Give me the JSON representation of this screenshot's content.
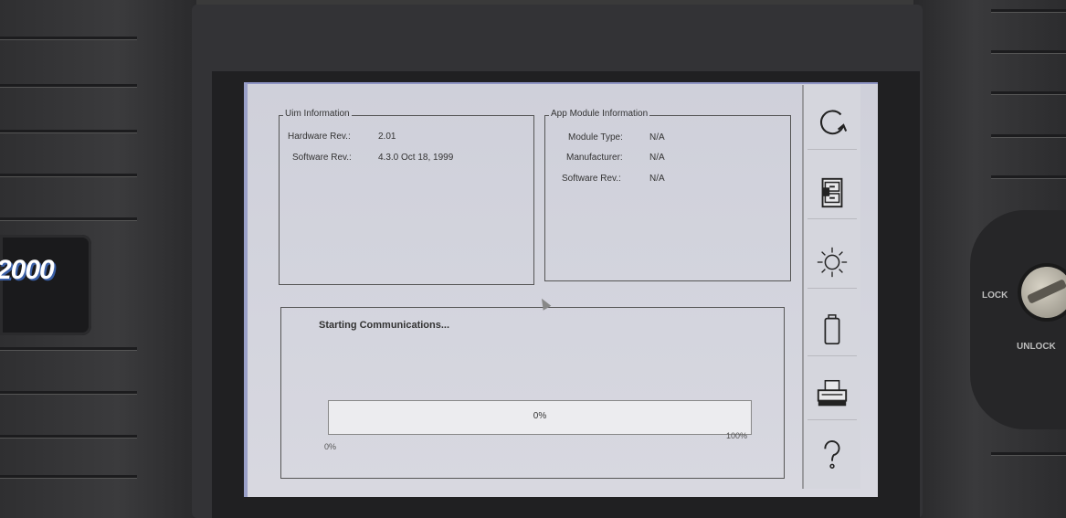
{
  "device": {
    "badge": "2000",
    "lock_label": "LOCK",
    "unlock_label": "UNLOCK"
  },
  "uim_info": {
    "title": "Uim Information",
    "rows": [
      {
        "label": "Hardware Rev.:",
        "value": "2.01"
      },
      {
        "label": "Software Rev.:",
        "value": "4.3.0 Oct 18, 1999"
      }
    ]
  },
  "app_module_info": {
    "title": "App Module Information",
    "rows": [
      {
        "label": "Module Type:",
        "value": "N/A"
      },
      {
        "label": "Manufacturer:",
        "value": "N/A"
      },
      {
        "label": "Software Rev.:",
        "value": "N/A"
      }
    ]
  },
  "status": {
    "message": "Starting Communications...",
    "progress_percent": 0,
    "progress_label": "0%",
    "scale_min": "0%",
    "scale_max": "100%"
  },
  "toolbar": {
    "icons": [
      "refresh-icon",
      "file-cabinet-icon",
      "brightness-icon",
      "battery-icon",
      "printer-icon",
      "help-icon"
    ]
  },
  "colors": {
    "screen_bg": "#d2d3dc",
    "toolbar_bg": "#d5d6dd",
    "housing": "#333336"
  }
}
